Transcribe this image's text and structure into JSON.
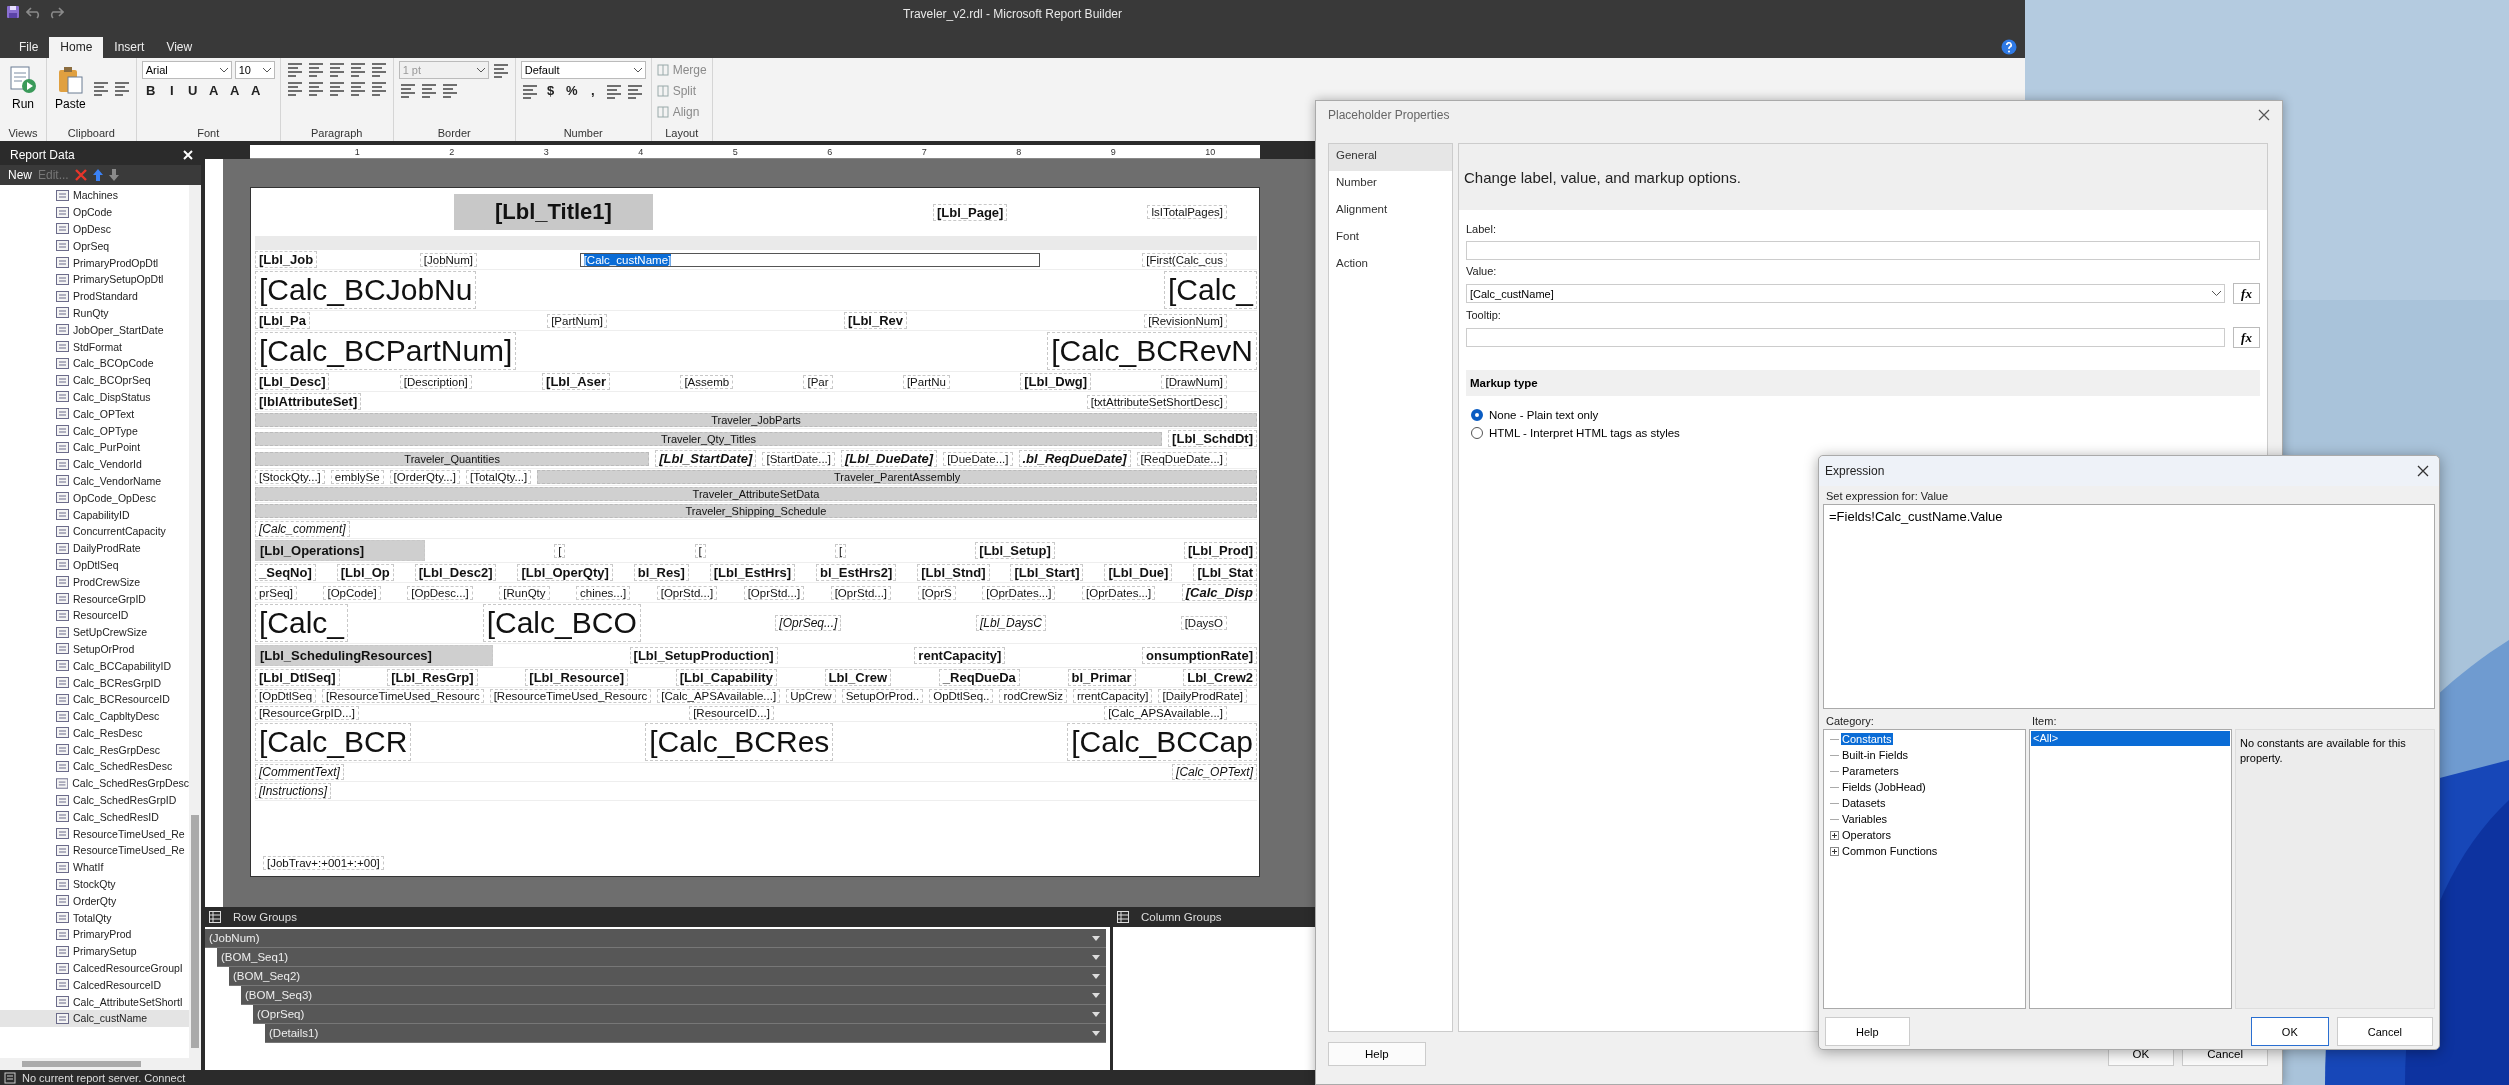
{
  "window": {
    "title": "Traveler_v2.rdl - Microsoft Report Builder"
  },
  "ribbon": {
    "tabs": [
      {
        "label": "File",
        "selected": false
      },
      {
        "label": "Home",
        "selected": true
      },
      {
        "label": "Insert",
        "selected": false
      },
      {
        "label": "View",
        "selected": false
      }
    ],
    "groups": [
      {
        "label": "Views",
        "rows": [
          [
            {
              "kind": "big",
              "label": "Run"
            }
          ]
        ]
      },
      {
        "label": "Clipboard",
        "rows": [
          [
            {
              "kind": "big",
              "label": "Paste"
            },
            {
              "kind": "icon"
            },
            {
              "kind": "icon"
            }
          ]
        ]
      },
      {
        "label": "Font",
        "rows": [
          [
            {
              "kind": "combo",
              "value": "Arial"
            },
            {
              "kind": "combo",
              "value": "10"
            }
          ],
          [
            {
              "kind": "glyph",
              "text": "B"
            },
            {
              "kind": "glyph",
              "text": "I"
            },
            {
              "kind": "glyph",
              "text": "U"
            },
            {
              "kind": "glyph",
              "text": "A"
            },
            {
              "kind": "glyph",
              "text": "A"
            },
            {
              "kind": "glyph",
              "text": "A"
            }
          ]
        ]
      },
      {
        "label": "Paragraph",
        "rows": [
          [
            {
              "kind": "icon"
            },
            {
              "kind": "icon"
            },
            {
              "kind": "icon"
            },
            {
              "kind": "icon"
            },
            {
              "kind": "icon"
            }
          ],
          [
            {
              "kind": "icon"
            },
            {
              "kind": "icon"
            },
            {
              "kind": "icon"
            },
            {
              "kind": "icon"
            },
            {
              "kind": "icon"
            }
          ]
        ]
      },
      {
        "label": "Border",
        "rows": [
          [
            {
              "kind": "combo",
              "value": "1 pt",
              "disabled": true
            },
            {
              "kind": "icon"
            }
          ],
          [
            {
              "kind": "icon"
            },
            {
              "kind": "icon"
            },
            {
              "kind": "icon"
            }
          ]
        ]
      },
      {
        "label": "Number",
        "rows": [
          [
            {
              "kind": "combo",
              "value": "Default"
            }
          ],
          [
            {
              "kind": "icon"
            },
            {
              "kind": "glyph",
              "text": "$"
            },
            {
              "kind": "glyph",
              "text": "%"
            },
            {
              "kind": "glyph",
              "text": ","
            },
            {
              "kind": "icon"
            },
            {
              "kind": "icon"
            }
          ]
        ]
      },
      {
        "label": "Layout",
        "rows": [
          [
            {
              "kind": "small",
              "label": "Merge",
              "disabled": true
            }
          ],
          [
            {
              "kind": "small",
              "label": "Split",
              "disabled": true
            }
          ],
          [
            {
              "kind": "small",
              "label": "Align",
              "disabled": true
            }
          ]
        ]
      }
    ]
  },
  "report_data": {
    "title": "Report Data",
    "toolbar": [
      {
        "label": "New",
        "disabled": false
      },
      {
        "label": "Edit...",
        "disabled": true
      }
    ],
    "fields": [
      {
        "label": "Machines",
        "selected": false
      },
      {
        "label": "OpCode",
        "selected": false
      },
      {
        "label": "OpDesc",
        "selected": false
      },
      {
        "label": "OprSeq",
        "selected": false
      },
      {
        "label": "PrimaryProdOpDtl",
        "selected": false
      },
      {
        "label": "PrimarySetupOpDtl",
        "selected": false
      },
      {
        "label": "ProdStandard",
        "selected": false
      },
      {
        "label": "RunQty",
        "selected": false
      },
      {
        "label": "JobOper_StartDate",
        "selected": false
      },
      {
        "label": "StdFormat",
        "selected": false
      },
      {
        "label": "Calc_BCOpCode",
        "selected": false
      },
      {
        "label": "Calc_BCOprSeq",
        "selected": false
      },
      {
        "label": "Calc_DispStatus",
        "selected": false
      },
      {
        "label": "Calc_OPText",
        "selected": false
      },
      {
        "label": "Calc_OPType",
        "selected": false
      },
      {
        "label": "Calc_PurPoint",
        "selected": false
      },
      {
        "label": "Calc_VendorId",
        "selected": false
      },
      {
        "label": "Calc_VendorName",
        "selected": false
      },
      {
        "label": "OpCode_OpDesc",
        "selected": false
      },
      {
        "label": "CapabilityID",
        "selected": false
      },
      {
        "label": "ConcurrentCapacity",
        "selected": false
      },
      {
        "label": "DailyProdRate",
        "selected": false
      },
      {
        "label": "OpDtlSeq",
        "selected": false
      },
      {
        "label": "ProdCrewSize",
        "selected": false
      },
      {
        "label": "ResourceGrpID",
        "selected": false
      },
      {
        "label": "ResourceID",
        "selected": false
      },
      {
        "label": "SetUpCrewSize",
        "selected": false
      },
      {
        "label": "SetupOrProd",
        "selected": false
      },
      {
        "label": "Calc_BCCapabilityID",
        "selected": false
      },
      {
        "label": "Calc_BCResGrpID",
        "selected": false
      },
      {
        "label": "Calc_BCResourceID",
        "selected": false
      },
      {
        "label": "Calc_CapbltyDesc",
        "selected": false
      },
      {
        "label": "Calc_ResDesc",
        "selected": false
      },
      {
        "label": "Calc_ResGrpDesc",
        "selected": false
      },
      {
        "label": "Calc_SchedResDesc",
        "selected": false
      },
      {
        "label": "Calc_SchedResGrpDesc",
        "selected": false
      },
      {
        "label": "Calc_SchedResGrpID",
        "selected": false
      },
      {
        "label": "Calc_SchedResID",
        "selected": false
      },
      {
        "label": "ResourceTimeUsed_Re",
        "selected": false
      },
      {
        "label": "ResourceTimeUsed_Re",
        "selected": false
      },
      {
        "label": "WhatIf",
        "selected": false
      },
      {
        "label": "StockQty",
        "selected": false
      },
      {
        "label": "OrderQty",
        "selected": false
      },
      {
        "label": "TotalQty",
        "selected": false
      },
      {
        "label": "PrimaryProd",
        "selected": false
      },
      {
        "label": "PrimarySetup",
        "selected": false
      },
      {
        "label": "CalcedResourceGroupI",
        "selected": false
      },
      {
        "label": "CalcedResourceID",
        "selected": false
      },
      {
        "label": "Calc_AttributeSetShortI",
        "selected": false
      },
      {
        "label": "Calc_custName",
        "selected": true
      }
    ]
  },
  "report": {
    "ruler": [
      "1",
      "2",
      "3",
      "4",
      "5",
      "6",
      "7",
      "8",
      "9",
      "10"
    ],
    "sections": [
      {
        "items": [
          {
            "text": "[Lbl_Title1]",
            "kind": "title",
            "selected": false
          },
          {
            "text": "[Lbl_Page]",
            "kind": "label",
            "selected": false
          },
          {
            "text": "lsITotalPages]",
            "kind": "field",
            "selected": false
          }
        ]
      },
      {
        "items": [
          {
            "text": "[Lbl_Job",
            "kind": "label",
            "selected": false
          },
          {
            "text": "[JobNum]",
            "kind": "field",
            "selected": false
          },
          {
            "text": "[Calc_custName]",
            "kind": "field",
            "selected": true
          },
          {
            "text": "[First(Calc_cus",
            "kind": "field",
            "selected": false
          }
        ]
      },
      {
        "items": [
          {
            "text": "[Calc_BCJobNu",
            "kind": "big",
            "selected": false
          },
          {
            "text": "[Calc_",
            "kind": "big",
            "selected": false
          }
        ]
      },
      {
        "items": [
          {
            "text": "[Lbl_Pa",
            "kind": "label",
            "selected": false
          },
          {
            "text": "[PartNum]",
            "kind": "field",
            "selected": false
          },
          {
            "text": "[Lbl_Rev",
            "kind": "label",
            "selected": false
          },
          {
            "text": "[RevisionNum]",
            "kind": "field",
            "selected": false
          }
        ]
      },
      {
        "items": [
          {
            "text": "[Calc_BCPartNum]",
            "kind": "big",
            "selected": false
          },
          {
            "text": "[Calc_BCRevN",
            "kind": "big",
            "selected": false
          }
        ]
      },
      {
        "items": [
          {
            "text": "[Lbl_Desc]",
            "kind": "label",
            "selected": false
          },
          {
            "text": "[Description]",
            "kind": "field",
            "selected": false
          },
          {
            "text": "[Lbl_Aser",
            "kind": "label",
            "selected": false
          },
          {
            "text": "[Assemb",
            "kind": "field",
            "selected": false
          },
          {
            "text": "[Par",
            "kind": "field",
            "selected": false
          },
          {
            "text": "[PartNu",
            "kind": "field",
            "selected": false
          },
          {
            "text": "[Lbl_Dwg]",
            "kind": "label",
            "selected": false
          },
          {
            "text": "[DrawNum]",
            "kind": "field",
            "selected": false
          }
        ]
      },
      {
        "items": [
          {
            "text": "[lblAttributeSet]",
            "kind": "label",
            "selected": false
          },
          {
            "text": "[txtAttributeSetShortDesc]",
            "kind": "field",
            "selected": false
          }
        ]
      },
      {
        "items": [
          {
            "text": "Traveler_JobParts",
            "kind": "band",
            "selected": false
          }
        ]
      },
      {
        "items": [
          {
            "text": "Traveler_Qty_Titles",
            "kind": "band",
            "selected": false
          },
          {
            "text": "[Lbl_SchdDt]",
            "kind": "label",
            "selected": false
          }
        ]
      },
      {
        "items": [
          {
            "text": "Traveler_Quantities",
            "kind": "band",
            "selected": false
          },
          {
            "text": "[Lbl_StartDate]",
            "kind": "bolditalic",
            "selected": false
          },
          {
            "text": "[StartDate...]",
            "kind": "field",
            "selected": false
          },
          {
            "text": "[Lbl_DueDate]",
            "kind": "bolditalic",
            "selected": false
          },
          {
            "text": "[DueDate...]",
            "kind": "field",
            "selected": false
          },
          {
            "text": ".bl_ReqDueDate]",
            "kind": "bolditalic",
            "selected": false
          },
          {
            "text": "[ReqDueDate...]",
            "kind": "field",
            "selected": false
          }
        ]
      },
      {
        "items": [
          {
            "text": "[StockQty...]",
            "kind": "field",
            "selected": false
          },
          {
            "text": "emblySe",
            "kind": "field",
            "selected": false
          },
          {
            "text": "[OrderQty...]",
            "kind": "field",
            "selected": false
          },
          {
            "text": "[TotalQty...]",
            "kind": "field",
            "selected": false
          },
          {
            "text": "Traveler_ParentAssembly",
            "kind": "band",
            "selected": false
          }
        ]
      },
      {
        "items": [
          {
            "text": "Traveler_AttributeSetData",
            "kind": "band",
            "selected": false
          }
        ]
      },
      {
        "items": [
          {
            "text": "Traveler_Shipping_Schedule",
            "kind": "band",
            "selected": false
          }
        ]
      },
      {
        "items": [
          {
            "text": "[Calc_comment]",
            "kind": "italic",
            "selected": false
          }
        ]
      },
      {
        "items": [
          {
            "text": "[Lbl_Operations]",
            "kind": "heading",
            "selected": false
          },
          {
            "text": "[",
            "kind": "field",
            "selected": false
          },
          {
            "text": "[",
            "kind": "field",
            "selected": false
          },
          {
            "text": "[",
            "kind": "field",
            "selected": false
          },
          {
            "text": "[Lbl_Setup]",
            "kind": "label",
            "selected": false
          },
          {
            "text": "[Lbl_Prod]",
            "kind": "label",
            "selected": false
          }
        ]
      },
      {
        "items": [
          {
            "text": "_SeqNo]",
            "kind": "label",
            "selected": false
          },
          {
            "text": "[Lbl_Op",
            "kind": "label",
            "selected": false
          },
          {
            "text": "[Lbl_Desc2]",
            "kind": "label",
            "selected": false
          },
          {
            "text": "[Lbl_OperQty]",
            "kind": "label",
            "selected": false
          },
          {
            "text": "bl_Res]",
            "kind": "label",
            "selected": false
          },
          {
            "text": "[Lbl_EstHrs]",
            "kind": "label",
            "selected": false
          },
          {
            "text": "bl_EstHrs2]",
            "kind": "label",
            "selected": false
          },
          {
            "text": "[Lbl_Stnd]",
            "kind": "label",
            "selected": false
          },
          {
            "text": "[Lbl_Start]",
            "kind": "label",
            "selected": false
          },
          {
            "text": "[Lbl_Due]",
            "kind": "label",
            "selected": false
          },
          {
            "text": "[Lbl_Stat",
            "kind": "label",
            "selected": false
          }
        ]
      },
      {
        "items": [
          {
            "text": "prSeq]",
            "kind": "field",
            "selected": false
          },
          {
            "text": "[OpCode]",
            "kind": "field",
            "selected": false
          },
          {
            "text": "[OpDesc...]",
            "kind": "field",
            "selected": false
          },
          {
            "text": "[RunQty",
            "kind": "field",
            "selected": false
          },
          {
            "text": "chines...]",
            "kind": "field",
            "selected": false
          },
          {
            "text": "[OprStd...]",
            "kind": "field",
            "selected": false
          },
          {
            "text": "[OprStd...]",
            "kind": "field",
            "selected": false
          },
          {
            "text": "[OprStd...]",
            "kind": "field",
            "selected": false
          },
          {
            "text": "[OprS",
            "kind": "field",
            "selected": false
          },
          {
            "text": "[OprDates...]",
            "kind": "field",
            "selected": false
          },
          {
            "text": "[OprDates...]",
            "kind": "field",
            "selected": false
          },
          {
            "text": "[Calc_Disp",
            "kind": "bolditalic",
            "selected": false
          }
        ]
      },
      {
        "items": [
          {
            "text": "[Calc_",
            "kind": "big",
            "selected": false
          },
          {
            "text": "[Calc_BCO",
            "kind": "big",
            "selected": false
          },
          {
            "text": "[OprSeq...]",
            "kind": "italic",
            "selected": false
          },
          {
            "text": "[Lbl_DaysC",
            "kind": "italic",
            "selected": false
          },
          {
            "text": "[DaysO",
            "kind": "field",
            "selected": false
          }
        ]
      },
      {
        "items": [
          {
            "text": "[Lbl_SchedulingResources]",
            "kind": "heading",
            "selected": false
          },
          {
            "text": "[Lbl_SetupProduction]",
            "kind": "label",
            "selected": false
          },
          {
            "text": "rentCapacity]",
            "kind": "label",
            "selected": false
          },
          {
            "text": "onsumptionRate]",
            "kind": "label",
            "selected": false
          }
        ]
      },
      {
        "items": [
          {
            "text": "[Lbl_DtlSeq]",
            "kind": "label",
            "selected": false
          },
          {
            "text": "[Lbl_ResGrp]",
            "kind": "label",
            "selected": false
          },
          {
            "text": "[Lbl_Resource]",
            "kind": "label",
            "selected": false
          },
          {
            "text": "[Lbl_Capability",
            "kind": "label",
            "selected": false
          },
          {
            "text": "Lbl_Crew",
            "kind": "label",
            "selected": false
          },
          {
            "text": "_ReqDueDa",
            "kind": "label",
            "selected": false
          },
          {
            "text": "bl_Primar",
            "kind": "label",
            "selected": false
          },
          {
            "text": "Lbl_Crew2",
            "kind": "label",
            "selected": false
          }
        ]
      },
      {
        "items": [
          {
            "text": "[OpDtlSeq",
            "kind": "field",
            "selected": false
          },
          {
            "text": "[ResourceTimeUsed_Resourc",
            "kind": "field",
            "selected": false
          },
          {
            "text": "[ResourceTimeUsed_Resourc",
            "kind": "field",
            "selected": false
          },
          {
            "text": "[Calc_APSAvailable...]",
            "kind": "field",
            "selected": false
          },
          {
            "text": "UpCrew",
            "kind": "field",
            "selected": false
          },
          {
            "text": "SetupOrProd..",
            "kind": "field",
            "selected": false
          },
          {
            "text": "OpDtlSeq..",
            "kind": "field",
            "selected": false
          },
          {
            "text": "rodCrewSiz",
            "kind": "field",
            "selected": false
          },
          {
            "text": "rrentCapacity]",
            "kind": "field",
            "selected": false
          },
          {
            "text": "[DailyProdRate]",
            "kind": "field",
            "selected": false
          }
        ]
      },
      {
        "items": [
          {
            "text": "[ResourceGrpID...]",
            "kind": "field",
            "selected": false
          },
          {
            "text": "[ResourceID...]",
            "kind": "field",
            "selected": false
          },
          {
            "text": "[Calc_APSAvailable...]",
            "kind": "field",
            "selected": false
          }
        ]
      },
      {
        "items": [
          {
            "text": "[Calc_BCR",
            "kind": "big",
            "selected": false
          },
          {
            "text": "[Calc_BCRes",
            "kind": "big",
            "selected": false
          },
          {
            "text": "[Calc_BCCap",
            "kind": "big",
            "selected": false
          }
        ]
      },
      {
        "items": [
          {
            "text": "[CommentText]",
            "kind": "italic",
            "selected": false
          },
          {
            "text": "[Calc_OPText]",
            "kind": "italic",
            "selected": false
          }
        ]
      },
      {
        "items": [
          {
            "text": "[Instructions]",
            "kind": "italic",
            "selected": false
          }
        ]
      },
      {
        "items": [
          {
            "text": "[JobTrav+:+001+:+00]",
            "kind": "field",
            "selected": false
          }
        ]
      }
    ]
  },
  "row_groups": {
    "title": "Row Groups",
    "groups": [
      {
        "label": "(JobNum)",
        "children": [
          {
            "label": "(BOM_Seq1)",
            "children": [
              {
                "label": "(BOM_Seq2)",
                "children": [
                  {
                    "label": "(BOM_Seq3)",
                    "children": [
                      {
                        "label": "(OprSeq)",
                        "children": [
                          {
                            "label": "(Details1)"
                          }
                        ]
                      }
                    ]
                  }
                ]
              }
            ]
          }
        ]
      }
    ]
  },
  "column_groups": {
    "title": "Column Groups"
  },
  "status_bar": "No current report server. Connect",
  "placeholder_dialog": {
    "title": "Placeholder Properties",
    "nav": [
      {
        "label": "General",
        "selected": true
      },
      {
        "label": "Number",
        "selected": false
      },
      {
        "label": "Alignment",
        "selected": false
      },
      {
        "label": "Font",
        "selected": false
      },
      {
        "label": "Action",
        "selected": false
      }
    ],
    "heading": "Change label, value, and markup options.",
    "label_caption": "Label:",
    "value_caption": "Value:",
    "value": "[Calc_custName]",
    "value_fx": "fx",
    "tooltip_caption": "Tooltip:",
    "tooltip_fx": "fx",
    "markup_heading": "Markup type",
    "markup_options": [
      {
        "label": "None - Plain text only",
        "selected": true
      },
      {
        "label": "HTML - Interpret HTML tags as styles",
        "selected": false
      }
    ],
    "help_button": "Help",
    "buttons": [
      "OK",
      "Cancel"
    ]
  },
  "expression_dialog": {
    "title": "Expression",
    "caption": "Set expression for: Value",
    "expression": "=Fields!Calc_custName.Value",
    "category_caption": "Category:",
    "categories": [
      {
        "label": "Constants",
        "selected": true
      },
      {
        "label": "Built-in Fields",
        "selected": false
      },
      {
        "label": "Parameters",
        "selected": false
      },
      {
        "label": "Fields (JobHead)",
        "selected": false
      },
      {
        "label": "Datasets",
        "selected": false
      },
      {
        "label": "Variables",
        "selected": false
      },
      {
        "label": "Operators",
        "selected": false,
        "expanded": false
      },
      {
        "label": "Common Functions",
        "selected": false,
        "expanded": false
      }
    ],
    "item_caption": "Item:",
    "items": [
      {
        "label": "<All>",
        "selected": true
      }
    ],
    "description": "No constants are available for this property.",
    "help_button": "Help",
    "buttons": [
      "OK",
      "Cancel"
    ]
  }
}
